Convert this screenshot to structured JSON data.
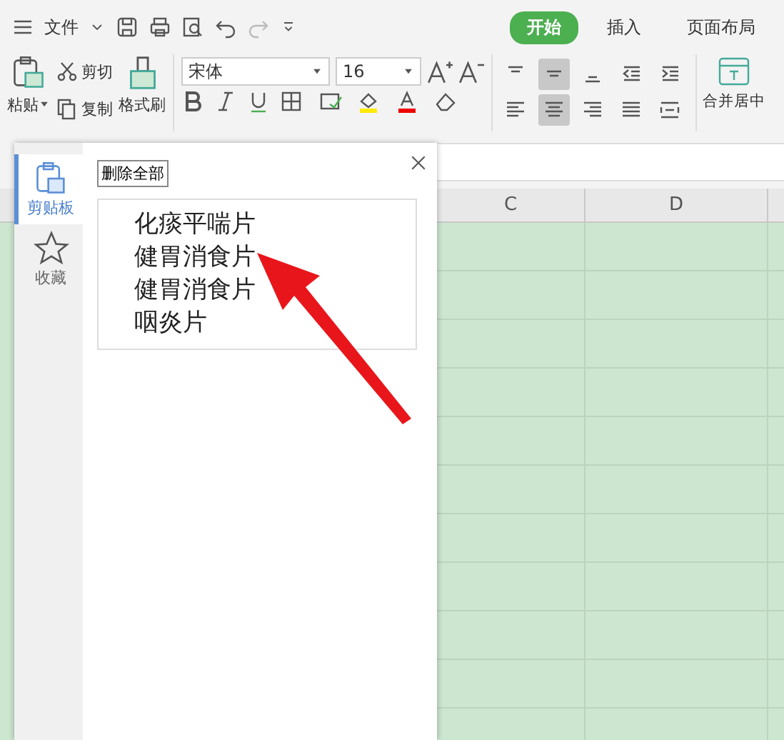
{
  "menu": {
    "file": "文件"
  },
  "tabs": [
    {
      "label": "开始",
      "selected": true
    },
    {
      "label": "插入",
      "selected": false
    },
    {
      "label": "页面布局",
      "selected": false
    }
  ],
  "clipboard_group": {
    "paste": "粘贴",
    "cut": "剪切",
    "copy": "复制",
    "format_painter": "格式刷"
  },
  "font": {
    "name": "宋体",
    "size": "16"
  },
  "align_buttons": [
    {
      "kind": "top",
      "selected": false
    },
    {
      "kind": "middle",
      "selected": true
    },
    {
      "kind": "bottom",
      "selected": false
    },
    {
      "kind": "outdent",
      "selected": false
    },
    {
      "kind": "indent",
      "selected": false
    },
    {
      "kind": "left",
      "selected": false
    },
    {
      "kind": "center",
      "selected": true
    },
    {
      "kind": "right",
      "selected": false
    },
    {
      "kind": "justify",
      "selected": false
    },
    {
      "kind": "distribute",
      "selected": false
    }
  ],
  "merge": {
    "label": "合并居中"
  },
  "panel": {
    "nav": [
      {
        "label": "剪贴板",
        "selected": true
      },
      {
        "label": "收藏",
        "selected": false
      }
    ],
    "clear_button": "删除全部",
    "clip_lines": [
      "化痰平喘片",
      "健胃消食片",
      "健胃消食片",
      "咽炎片"
    ]
  },
  "sheet": {
    "columns": [
      "C",
      "D"
    ]
  }
}
